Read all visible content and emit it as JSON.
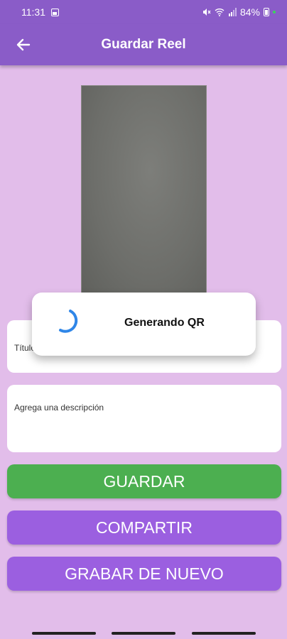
{
  "status_bar": {
    "time": "11:31",
    "battery": "84%",
    "icons": [
      "image-icon",
      "mute-icon",
      "wifi-icon",
      "signal-icon",
      "battery-icon"
    ]
  },
  "app_bar": {
    "title": "Guardar Reel",
    "back_icon": "arrow-left-icon"
  },
  "form": {
    "title_placeholder": "Título",
    "description_placeholder": "Agrega una descripción"
  },
  "buttons": {
    "save": "GUARDAR",
    "share": "COMPARTIR",
    "record_again": "GRABAR DE NUEVO"
  },
  "dialog": {
    "message": "Generando QR",
    "icon": "loading-spinner-icon"
  },
  "colors": {
    "app_bar": "#8a5cc8",
    "background": "#e2bdea",
    "save_button": "#4caf50",
    "secondary_button": "#9b5fe0",
    "spinner": "#2f86e8"
  }
}
